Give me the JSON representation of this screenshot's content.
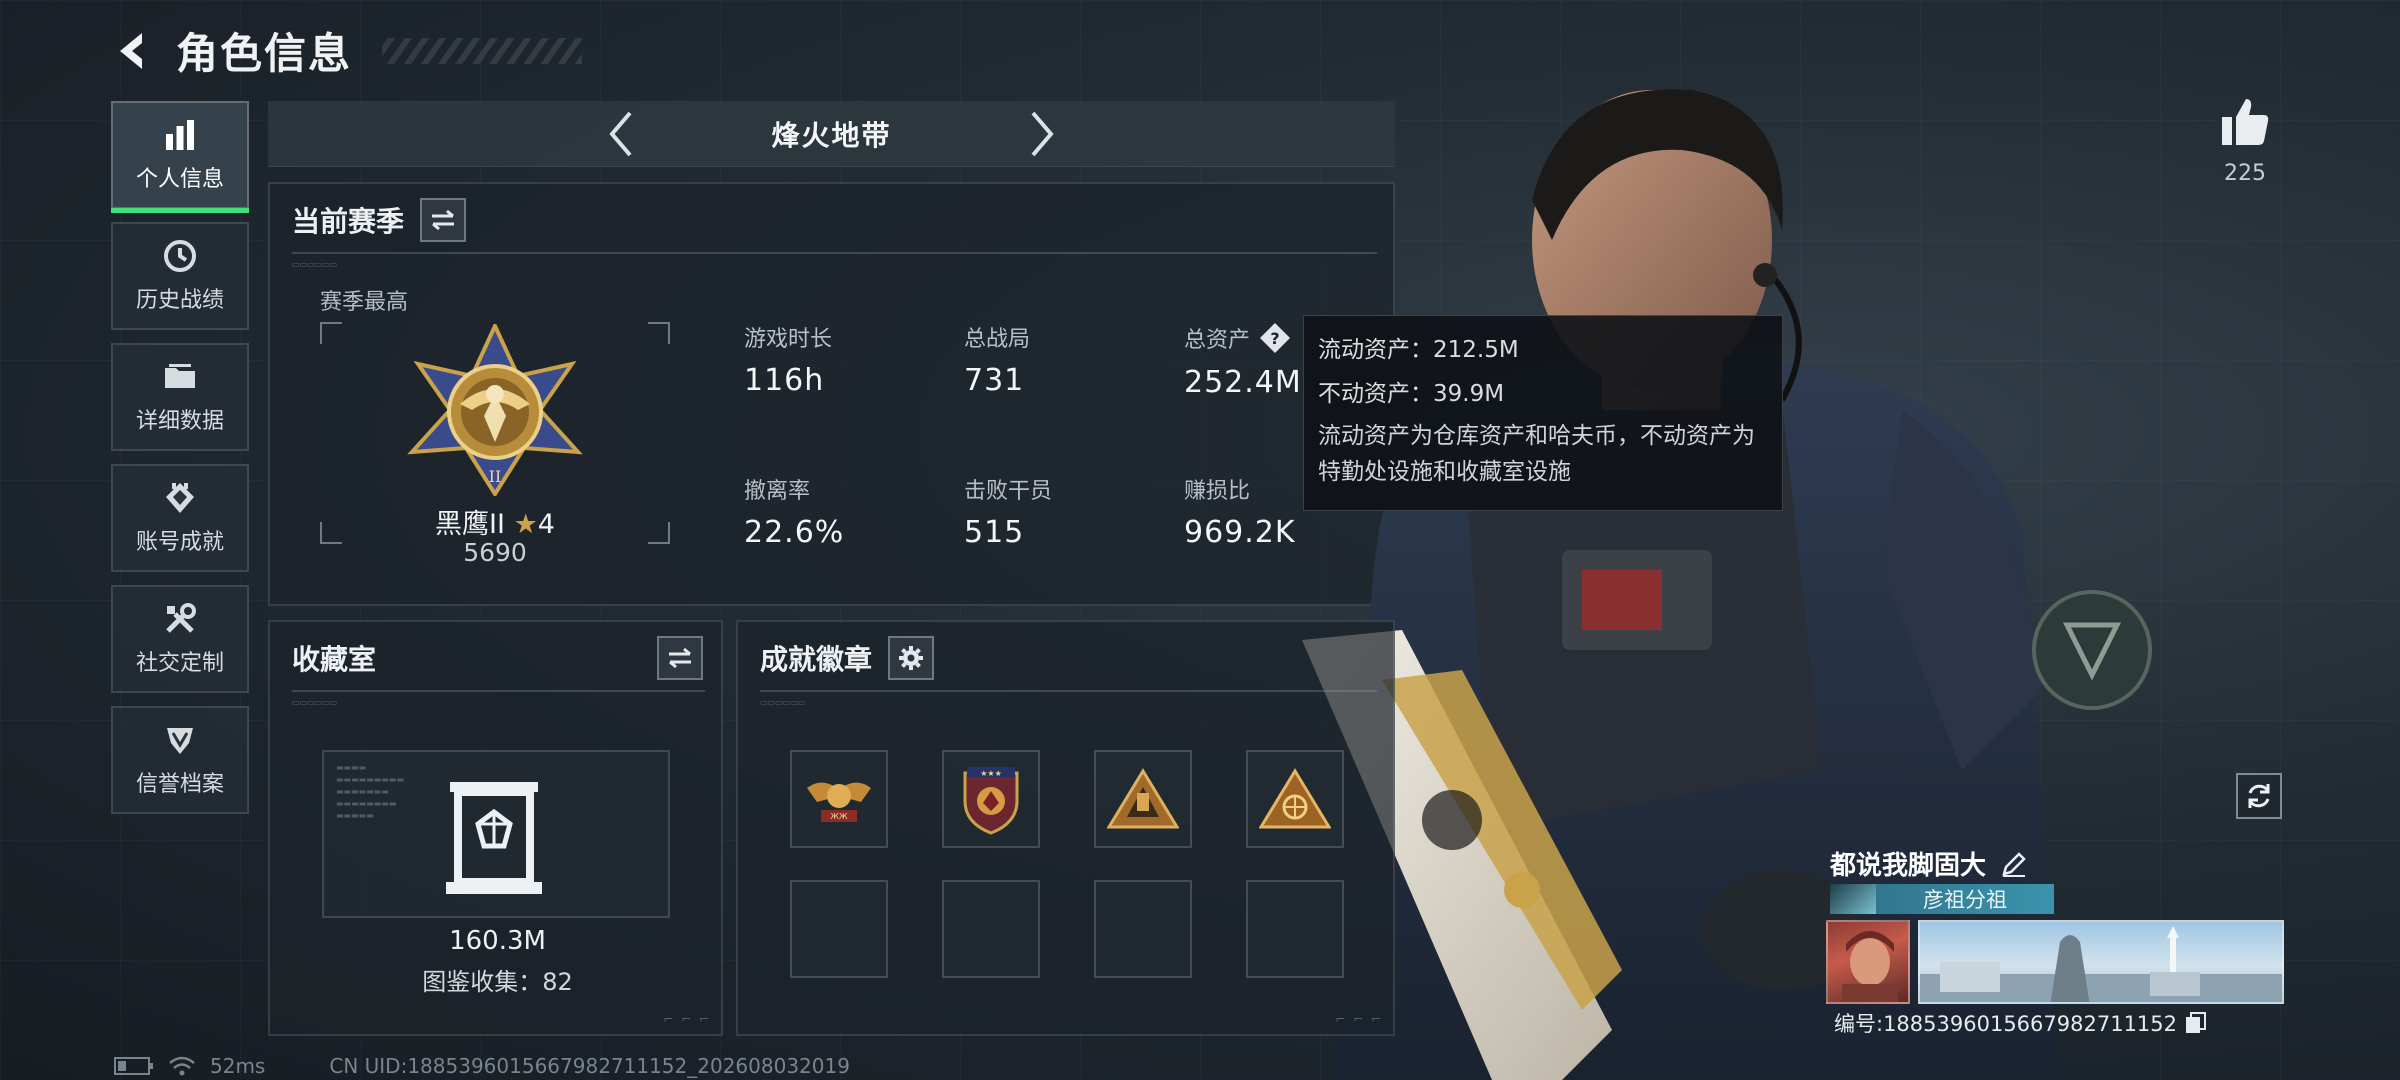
{
  "header": {
    "title": "角色信息"
  },
  "sidenav": {
    "items": [
      {
        "label": "个人信息",
        "icon": "bar-chart-icon",
        "active": true
      },
      {
        "label": "历史战绩",
        "icon": "history-clock-icon",
        "active": false
      },
      {
        "label": "详细数据",
        "icon": "folder-icon",
        "active": false
      },
      {
        "label": "账号成就",
        "icon": "achievement-icon",
        "active": false
      },
      {
        "label": "社交定制",
        "icon": "tools-icon",
        "active": false
      },
      {
        "label": "信誉档案",
        "icon": "reputation-icon",
        "active": false
      }
    ]
  },
  "modebar": {
    "title": "烽火地带"
  },
  "season": {
    "title": "当前赛季",
    "best_label": "赛季最高",
    "rank_name": "黑鹰II",
    "rank_stars": "4",
    "rank_score": "5690",
    "stats": [
      {
        "label": "游戏时长",
        "value": "116h"
      },
      {
        "label": "总战局",
        "value": "731"
      },
      {
        "label": "总资产",
        "value": "252.4M",
        "help": true
      },
      {
        "label": "撤离率",
        "value": "22.6%"
      },
      {
        "label": "击败干员",
        "value": "515"
      },
      {
        "label": "赚损比",
        "value": "969.2K"
      }
    ]
  },
  "tooltip": {
    "liquid": "流动资产：212.5M",
    "fixed": "不动资产：39.9M",
    "desc": "流动资产为仓库资产和哈夫币，不动资产为特勤处设施和收藏室设施"
  },
  "collection": {
    "title": "收藏室",
    "value": "160.3M",
    "count": "图鉴收集：82"
  },
  "badges": {
    "title": "成就徽章"
  },
  "like": {
    "count": "225"
  },
  "player": {
    "name": "都说我脚固大",
    "team": "彦祖分祖",
    "id": "编号:1885396015667982711152"
  },
  "footer": {
    "ping": "52ms",
    "uid": "CN UID:1885396015667982711152_202608032019"
  },
  "colors": {
    "accent": "#3fe07a",
    "panel": "#1c232a",
    "gold": "#c9a24a"
  }
}
